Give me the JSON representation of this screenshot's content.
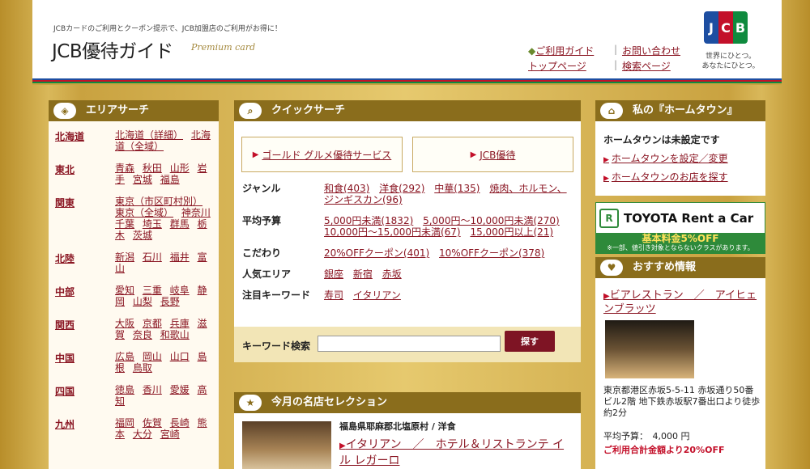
{
  "header": {
    "tagline": "JCBカードのご利用とクーポン提示で、JCB加盟店のご利用がお得に！",
    "logo": "JCB優待ガイド",
    "sublogo": "Premium card",
    "nav": {
      "guide": "ご利用ガイド",
      "contact": "お問い合わせ",
      "top": "トップページ",
      "search_page": "検索ページ"
    },
    "brand": "JCB",
    "slogan_1": "世界にひとつ。",
    "slogan_2": "あなたにひとつ。"
  },
  "area_search": {
    "title": "エリアサーチ",
    "regions": [
      {
        "name": "北海道",
        "prefs": [
          "北海道（詳細）",
          "北海道（全域）"
        ]
      },
      {
        "name": "東北",
        "prefs": [
          "青森",
          "秋田",
          "山形",
          "岩手",
          "宮城",
          "福島"
        ]
      },
      {
        "name": "関東",
        "prefs": [
          "東京（市区町村別）",
          "東京（全域）",
          "神奈川",
          "千葉",
          "埼玉",
          "群馬",
          "栃木",
          "茨城"
        ]
      },
      {
        "name": "北陸",
        "prefs": [
          "新潟",
          "石川",
          "福井",
          "富山"
        ]
      },
      {
        "name": "中部",
        "prefs": [
          "愛知",
          "三重",
          "岐阜",
          "静岡",
          "山梨",
          "長野"
        ]
      },
      {
        "name": "関西",
        "prefs": [
          "大阪",
          "京都",
          "兵庫",
          "滋賀",
          "奈良",
          "和歌山"
        ]
      },
      {
        "name": "中国",
        "prefs": [
          "広島",
          "岡山",
          "山口",
          "島根",
          "鳥取"
        ]
      },
      {
        "name": "四国",
        "prefs": [
          "徳島",
          "香川",
          "愛媛",
          "高知"
        ]
      },
      {
        "name": "九州",
        "prefs": [
          "福岡",
          "佐賀",
          "長崎",
          "熊本",
          "大分",
          "宮崎"
        ]
      }
    ]
  },
  "quick_search": {
    "title": "クイックサーチ",
    "box_1": "ゴールド グルメ優待サービス",
    "box_2": "JCB優待",
    "rows": [
      {
        "label": "ジャンル",
        "values": [
          "和食(403)",
          "洋食(292)",
          "中華(135)",
          "焼肉、ホルモン、ジンギスカン(96)"
        ]
      },
      {
        "label": "平均予算",
        "values": [
          "5,000円未満(1832)",
          "5,000円～10,000円未満(270)",
          "10,000円～15,000円未満(67)",
          "15,000円以上(21)"
        ]
      },
      {
        "label": "こだわり",
        "values": [
          "20%OFFクーポン(401)",
          "10%OFFクーポン(378)"
        ]
      },
      {
        "label": "人気エリア",
        "values": [
          "銀座",
          "新宿",
          "赤坂"
        ]
      },
      {
        "label": "注目キーワード",
        "values": [
          "寿司",
          "イタリアン"
        ]
      }
    ],
    "keyword_label": "キーワード検索",
    "keyword_value": "",
    "search_button": "探す"
  },
  "selection": {
    "title": "今月の名店セレクション",
    "location": "福島県耶麻郡北塩原村 / 洋食",
    "shop": "イタリアン　／　ホテル＆リストランテ イル レガーロ"
  },
  "hometown": {
    "title": "私の『ホームタウン』",
    "status": "ホームタウンは未設定です",
    "link_1": "ホームタウンを設定／変更",
    "link_2": "ホームタウンのお店を探す"
  },
  "toyota": {
    "name": "TOYOTA Rent a Car",
    "logo_letter": "R",
    "offer": "基本料金5%OFF",
    "note": "※一部、値引き対象とならないクラスがあります。"
  },
  "recommend": {
    "title": "おすすめ情報",
    "shop": "ビアレストラン　／　アイヒェンブラッツ",
    "address": "東京都港区赤坂5-5-11 赤坂通り50番ビル2階 地下鉄赤坂駅7番出口より徒歩約2分",
    "price": "平均予算：　4,000 円",
    "promo": "ご利用合計金額より20%OFF"
  },
  "colors": {
    "accent_brown": "#8a6d1c",
    "link": "#8a1522",
    "button": "#7e1424",
    "toyota_green": "#2e8a3a"
  }
}
